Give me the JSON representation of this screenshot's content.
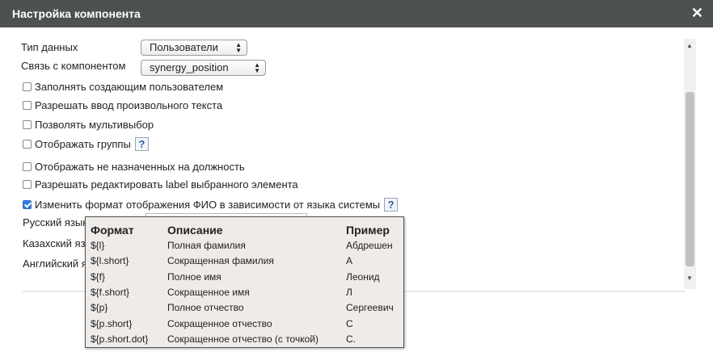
{
  "dialog": {
    "title": "Настройка компонента",
    "close_symbol": "✕"
  },
  "fields": {
    "data_type_label": "Тип данных",
    "data_type_value": "Пользователи",
    "link_label": "Связь с компонентом",
    "link_value": "synergy_position"
  },
  "checkboxes": [
    {
      "label": "Заполнять создающим пользователем",
      "checked": false
    },
    {
      "label": "Разрешать ввод произвольного текста",
      "checked": false
    },
    {
      "label": "Позволять мультивыбор",
      "checked": false
    },
    {
      "label": "Отображать группы",
      "checked": false
    },
    {
      "label": "Отображать не назначенных на должность",
      "checked": false
    },
    {
      "label": "Разрешать редактировать label выбранного элемента",
      "checked": false
    },
    {
      "label": "Изменить формат отображения ФИО в зависимости от языка системы",
      "checked": true
    }
  ],
  "help_symbol": "?",
  "language_labels": [
    "Русский язык",
    "Казахский язык",
    "Английский язык"
  ],
  "tooltip": {
    "headers": [
      "Формат",
      "Описание",
      "Пример"
    ],
    "rows": [
      [
        "${l}",
        "Полная фамилия",
        "Абдрешен"
      ],
      [
        "${l.short}",
        "Сокращенная фамилия",
        "А"
      ],
      [
        "${f}",
        "Полное имя",
        "Леонид"
      ],
      [
        "${f.short}",
        "Сокращенное имя",
        "Л"
      ],
      [
        "${p}",
        "Полное отчество",
        "Сергеевич"
      ],
      [
        "${p.short}",
        "Сокращенное отчество",
        "С"
      ],
      [
        "${p.short.dot}",
        "Сокращенное отчество (с точкой)",
        "С."
      ]
    ]
  },
  "colors": {
    "titlebar": "#4e5151",
    "checkbox_checked": "#2f7bd9",
    "tooltip_bg": "#efebe9"
  }
}
